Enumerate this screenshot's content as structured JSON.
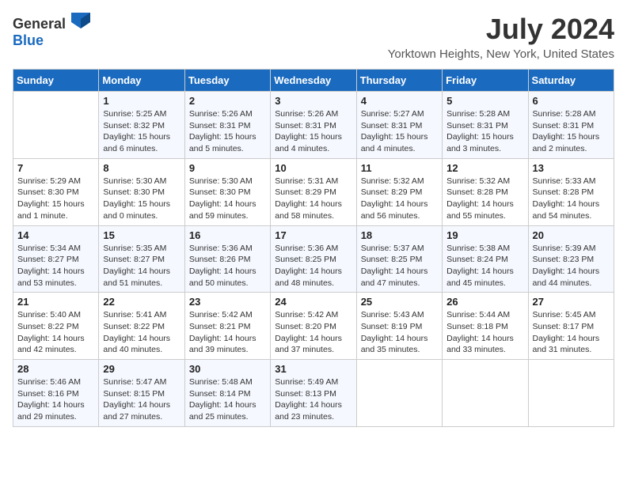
{
  "logo": {
    "text_general": "General",
    "text_blue": "Blue"
  },
  "title": "July 2024",
  "location": "Yorktown Heights, New York, United States",
  "days_of_week": [
    "Sunday",
    "Monday",
    "Tuesday",
    "Wednesday",
    "Thursday",
    "Friday",
    "Saturday"
  ],
  "weeks": [
    [
      {
        "day": "",
        "info": ""
      },
      {
        "day": "1",
        "info": "Sunrise: 5:25 AM\nSunset: 8:32 PM\nDaylight: 15 hours\nand 6 minutes."
      },
      {
        "day": "2",
        "info": "Sunrise: 5:26 AM\nSunset: 8:31 PM\nDaylight: 15 hours\nand 5 minutes."
      },
      {
        "day": "3",
        "info": "Sunrise: 5:26 AM\nSunset: 8:31 PM\nDaylight: 15 hours\nand 4 minutes."
      },
      {
        "day": "4",
        "info": "Sunrise: 5:27 AM\nSunset: 8:31 PM\nDaylight: 15 hours\nand 4 minutes."
      },
      {
        "day": "5",
        "info": "Sunrise: 5:28 AM\nSunset: 8:31 PM\nDaylight: 15 hours\nand 3 minutes."
      },
      {
        "day": "6",
        "info": "Sunrise: 5:28 AM\nSunset: 8:31 PM\nDaylight: 15 hours\nand 2 minutes."
      }
    ],
    [
      {
        "day": "7",
        "info": "Sunrise: 5:29 AM\nSunset: 8:30 PM\nDaylight: 15 hours\nand 1 minute."
      },
      {
        "day": "8",
        "info": "Sunrise: 5:30 AM\nSunset: 8:30 PM\nDaylight: 15 hours\nand 0 minutes."
      },
      {
        "day": "9",
        "info": "Sunrise: 5:30 AM\nSunset: 8:30 PM\nDaylight: 14 hours\nand 59 minutes."
      },
      {
        "day": "10",
        "info": "Sunrise: 5:31 AM\nSunset: 8:29 PM\nDaylight: 14 hours\nand 58 minutes."
      },
      {
        "day": "11",
        "info": "Sunrise: 5:32 AM\nSunset: 8:29 PM\nDaylight: 14 hours\nand 56 minutes."
      },
      {
        "day": "12",
        "info": "Sunrise: 5:32 AM\nSunset: 8:28 PM\nDaylight: 14 hours\nand 55 minutes."
      },
      {
        "day": "13",
        "info": "Sunrise: 5:33 AM\nSunset: 8:28 PM\nDaylight: 14 hours\nand 54 minutes."
      }
    ],
    [
      {
        "day": "14",
        "info": "Sunrise: 5:34 AM\nSunset: 8:27 PM\nDaylight: 14 hours\nand 53 minutes."
      },
      {
        "day": "15",
        "info": "Sunrise: 5:35 AM\nSunset: 8:27 PM\nDaylight: 14 hours\nand 51 minutes."
      },
      {
        "day": "16",
        "info": "Sunrise: 5:36 AM\nSunset: 8:26 PM\nDaylight: 14 hours\nand 50 minutes."
      },
      {
        "day": "17",
        "info": "Sunrise: 5:36 AM\nSunset: 8:25 PM\nDaylight: 14 hours\nand 48 minutes."
      },
      {
        "day": "18",
        "info": "Sunrise: 5:37 AM\nSunset: 8:25 PM\nDaylight: 14 hours\nand 47 minutes."
      },
      {
        "day": "19",
        "info": "Sunrise: 5:38 AM\nSunset: 8:24 PM\nDaylight: 14 hours\nand 45 minutes."
      },
      {
        "day": "20",
        "info": "Sunrise: 5:39 AM\nSunset: 8:23 PM\nDaylight: 14 hours\nand 44 minutes."
      }
    ],
    [
      {
        "day": "21",
        "info": "Sunrise: 5:40 AM\nSunset: 8:22 PM\nDaylight: 14 hours\nand 42 minutes."
      },
      {
        "day": "22",
        "info": "Sunrise: 5:41 AM\nSunset: 8:22 PM\nDaylight: 14 hours\nand 40 minutes."
      },
      {
        "day": "23",
        "info": "Sunrise: 5:42 AM\nSunset: 8:21 PM\nDaylight: 14 hours\nand 39 minutes."
      },
      {
        "day": "24",
        "info": "Sunrise: 5:42 AM\nSunset: 8:20 PM\nDaylight: 14 hours\nand 37 minutes."
      },
      {
        "day": "25",
        "info": "Sunrise: 5:43 AM\nSunset: 8:19 PM\nDaylight: 14 hours\nand 35 minutes."
      },
      {
        "day": "26",
        "info": "Sunrise: 5:44 AM\nSunset: 8:18 PM\nDaylight: 14 hours\nand 33 minutes."
      },
      {
        "day": "27",
        "info": "Sunrise: 5:45 AM\nSunset: 8:17 PM\nDaylight: 14 hours\nand 31 minutes."
      }
    ],
    [
      {
        "day": "28",
        "info": "Sunrise: 5:46 AM\nSunset: 8:16 PM\nDaylight: 14 hours\nand 29 minutes."
      },
      {
        "day": "29",
        "info": "Sunrise: 5:47 AM\nSunset: 8:15 PM\nDaylight: 14 hours\nand 27 minutes."
      },
      {
        "day": "30",
        "info": "Sunrise: 5:48 AM\nSunset: 8:14 PM\nDaylight: 14 hours\nand 25 minutes."
      },
      {
        "day": "31",
        "info": "Sunrise: 5:49 AM\nSunset: 8:13 PM\nDaylight: 14 hours\nand 23 minutes."
      },
      {
        "day": "",
        "info": ""
      },
      {
        "day": "",
        "info": ""
      },
      {
        "day": "",
        "info": ""
      }
    ]
  ]
}
